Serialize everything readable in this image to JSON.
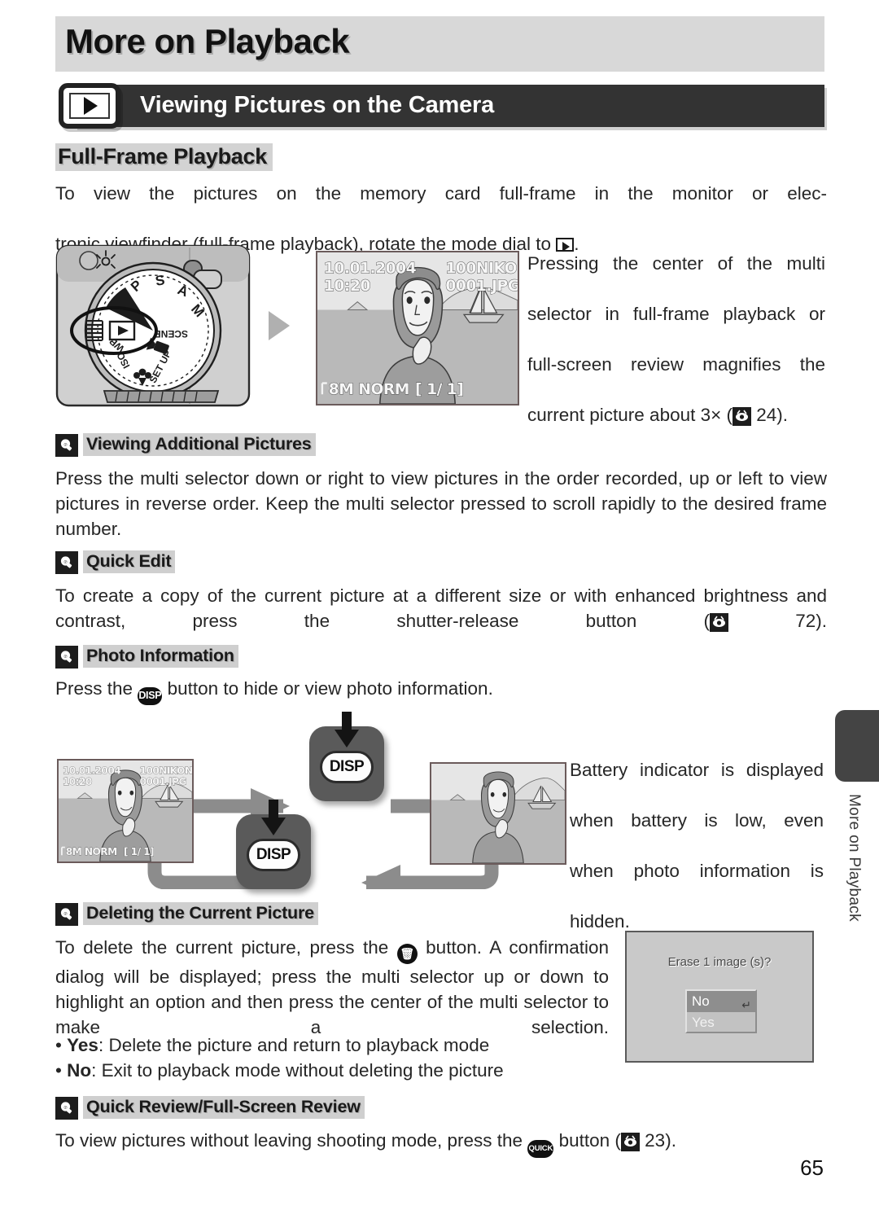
{
  "chapter": {
    "title": "More on Playback"
  },
  "section": {
    "title": "Viewing Pictures on the Camera",
    "icon": "playback-icon"
  },
  "subhead": {
    "full_frame": "Full-Frame Playback"
  },
  "intro": {
    "line1": "To view the pictures on the memory card full-frame in the monitor or elec-",
    "line2_a": "tronic viewfinder (full-frame playback), rotate the mode dial to",
    "line2_b": "."
  },
  "mode_dial": {
    "labels": [
      "P",
      "S",
      "A",
      "M",
      "SCENE",
      "SET UP",
      "ISO",
      "WB"
    ],
    "icons": [
      "playback-icon",
      "movie-icon",
      "macro-flower-icon",
      "lamp-icon"
    ]
  },
  "lcd_screen": {
    "date": "10.01.2004",
    "time": "10:20",
    "folder": "100NIKON",
    "filename": "0001.JPG",
    "quality_size": "8M",
    "quality_mode": "NORM",
    "frame_counter": "[    1/        1]"
  },
  "magnify_note": {
    "line1": "Pressing the center of the multi",
    "line2": "selector in full-frame playback or",
    "line3": "full-screen review magnifies the",
    "line4_a": "current picture about 3× (",
    "line4_b": "24)."
  },
  "tips": [
    {
      "id": "viewing-additional-pictures",
      "label": "Viewing Additional Pictures",
      "body": "Press the multi selector down or right to view pictures in the order recorded, up or left to view pictures in reverse order.  Keep the multi selector pressed to scroll rapidly to the desired frame number."
    },
    {
      "id": "quick-edit",
      "label": "Quick Edit",
      "body_a": "To create a copy of the current picture at a different size or with enhanced brightness and contrast, press the shutter-release button (",
      "body_b": "72)."
    },
    {
      "id": "photo-information",
      "label": "Photo Information",
      "body_a": "Press the",
      "body_b": "button to hide or view photo information."
    },
    {
      "id": "deleting-the-current-picture",
      "label": "Deleting the Current Picture",
      "body_a": "To delete the current picture, press the",
      "body_b": "button.  A confirmation dialog will be displayed; press the multi selector up or down to highlight an option and then press the center of the multi selector to make a selection.",
      "bullet_yes_key": "Yes",
      "bullet_yes_text": ": Delete the picture and return to playback mode",
      "bullet_no_key": "No",
      "bullet_no_text": ": Exit to playback mode without deleting the picture"
    },
    {
      "id": "quick-review-full-screen-review",
      "label": "Quick Review/Full-Screen Review",
      "body_a": "To view pictures without leaving shooting mode, press the",
      "body_b": "button (",
      "body_c": "23)."
    }
  ],
  "disp_diagram": {
    "button_label": "DISP",
    "button_label2": "DISP"
  },
  "battery_note": {
    "line1": "Battery indicator is displayed",
    "line2": "when battery is low, even",
    "line3": "when photo information is",
    "line4": "hidden."
  },
  "erase_dialog": {
    "title": "Erase 1 image (s)?",
    "option_no": "No",
    "option_yes": "Yes",
    "enter_glyph": "↵"
  },
  "edge_tab": {
    "label": "More on Playback"
  },
  "page_number": "65"
}
